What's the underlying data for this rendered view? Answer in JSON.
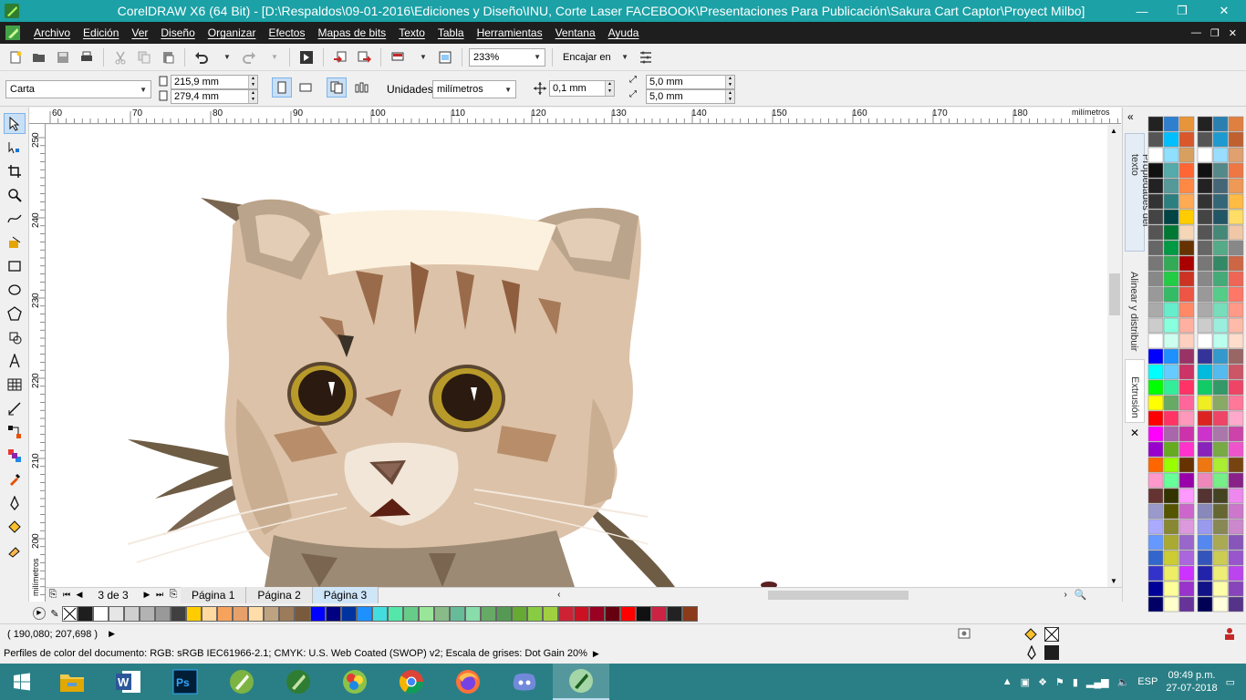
{
  "window": {
    "title": "CorelDRAW X6 (64 Bit) - [D:\\Respaldos\\09-01-2016\\Ediciones y Diseño\\INU, Corte Laser FACEBOOK\\Presentaciones Para Publicación\\Sakura Cart Captor\\Proyect Milbo]",
    "minimize": "—",
    "restore": "❐",
    "close": "✕"
  },
  "menu": {
    "items": [
      "Archivo",
      "Edición",
      "Ver",
      "Diseño",
      "Organizar",
      "Efectos",
      "Mapas de bits",
      "Texto",
      "Tabla",
      "Herramientas",
      "Ventana",
      "Ayuda"
    ],
    "inner_min": "—",
    "inner_restore": "❐",
    "inner_close": "✕"
  },
  "toolbar": {
    "zoom": "233%",
    "snap_label": "Encajar en"
  },
  "property_bar": {
    "page_preset": "Carta",
    "width": "215,9 mm",
    "height": "279,4 mm",
    "units_label": "Unidades:",
    "units_value": "milímetros",
    "nudge": "0,1 mm",
    "dup_x": "5,0 mm",
    "dup_y": "5,0 mm"
  },
  "rulers": {
    "h_ticks": [
      "60",
      "70",
      "80",
      "90",
      "100",
      "110",
      "120",
      "130",
      "140",
      "150",
      "160",
      "170",
      "180"
    ],
    "h_unit": "milímetros",
    "v_ticks": [
      "250",
      "240",
      "230",
      "220",
      "210",
      "200"
    ],
    "v_unit": "milímetros"
  },
  "dockers": {
    "tab1": "Propiedades del texto",
    "tab2": "Alinear y distribuir",
    "tab3": "Extrusión"
  },
  "pages": {
    "counter": "3 de 3",
    "tabs": [
      "Página 1",
      "Página 2",
      "Página 3"
    ],
    "active_index": 2
  },
  "status": {
    "coords": "( 190,080; 207,698 )",
    "color_profiles": "Perfiles de color del documento: RGB: sRGB IEC61966-2.1; CMYK: U.S. Web Coated (SWOP) v2; Escala de grises: Dot Gain 20%"
  },
  "taskbar": {
    "language": "ESP",
    "time": "09:49 p.m.",
    "date": "27-07-2018",
    "apps": [
      "file-explorer",
      "word",
      "photoshop",
      "coreldraw-a",
      "coreldraw-b",
      "corel-photo-paint",
      "chrome",
      "firefox",
      "discord",
      "coreldraw-active"
    ]
  },
  "colors": {
    "title_bar": "#1ba1a6",
    "menu_bar": "#1e1e1e",
    "taskbar": "#2a7f86",
    "bottom_palette": [
      "#1e1e1e",
      "#ffffff",
      "#e6e6e6",
      "#cfcfcf",
      "#b3b3b3",
      "#999999",
      "#404040",
      "#ffcc00",
      "#ffd9a0",
      "#f7a35c",
      "#e8a06a",
      "#ffdca8",
      "#bfa280",
      "#9c7b5a",
      "#7a5a3c",
      "#0000ff",
      "#000080",
      "#0033a0",
      "#1e90ff",
      "#44dddd",
      "#55e6aa",
      "#66cc88",
      "#99e699",
      "#88bb88",
      "#66bb99",
      "#88ddaa",
      "#66aa66",
      "#559955",
      "#66aa33",
      "#88cc44",
      "#a0d040",
      "#cc2233",
      "#cc1122",
      "#990022",
      "#660011",
      "#ff0000",
      "#111111",
      "#cc2244",
      "#222222",
      "#8b3a1a"
    ]
  }
}
